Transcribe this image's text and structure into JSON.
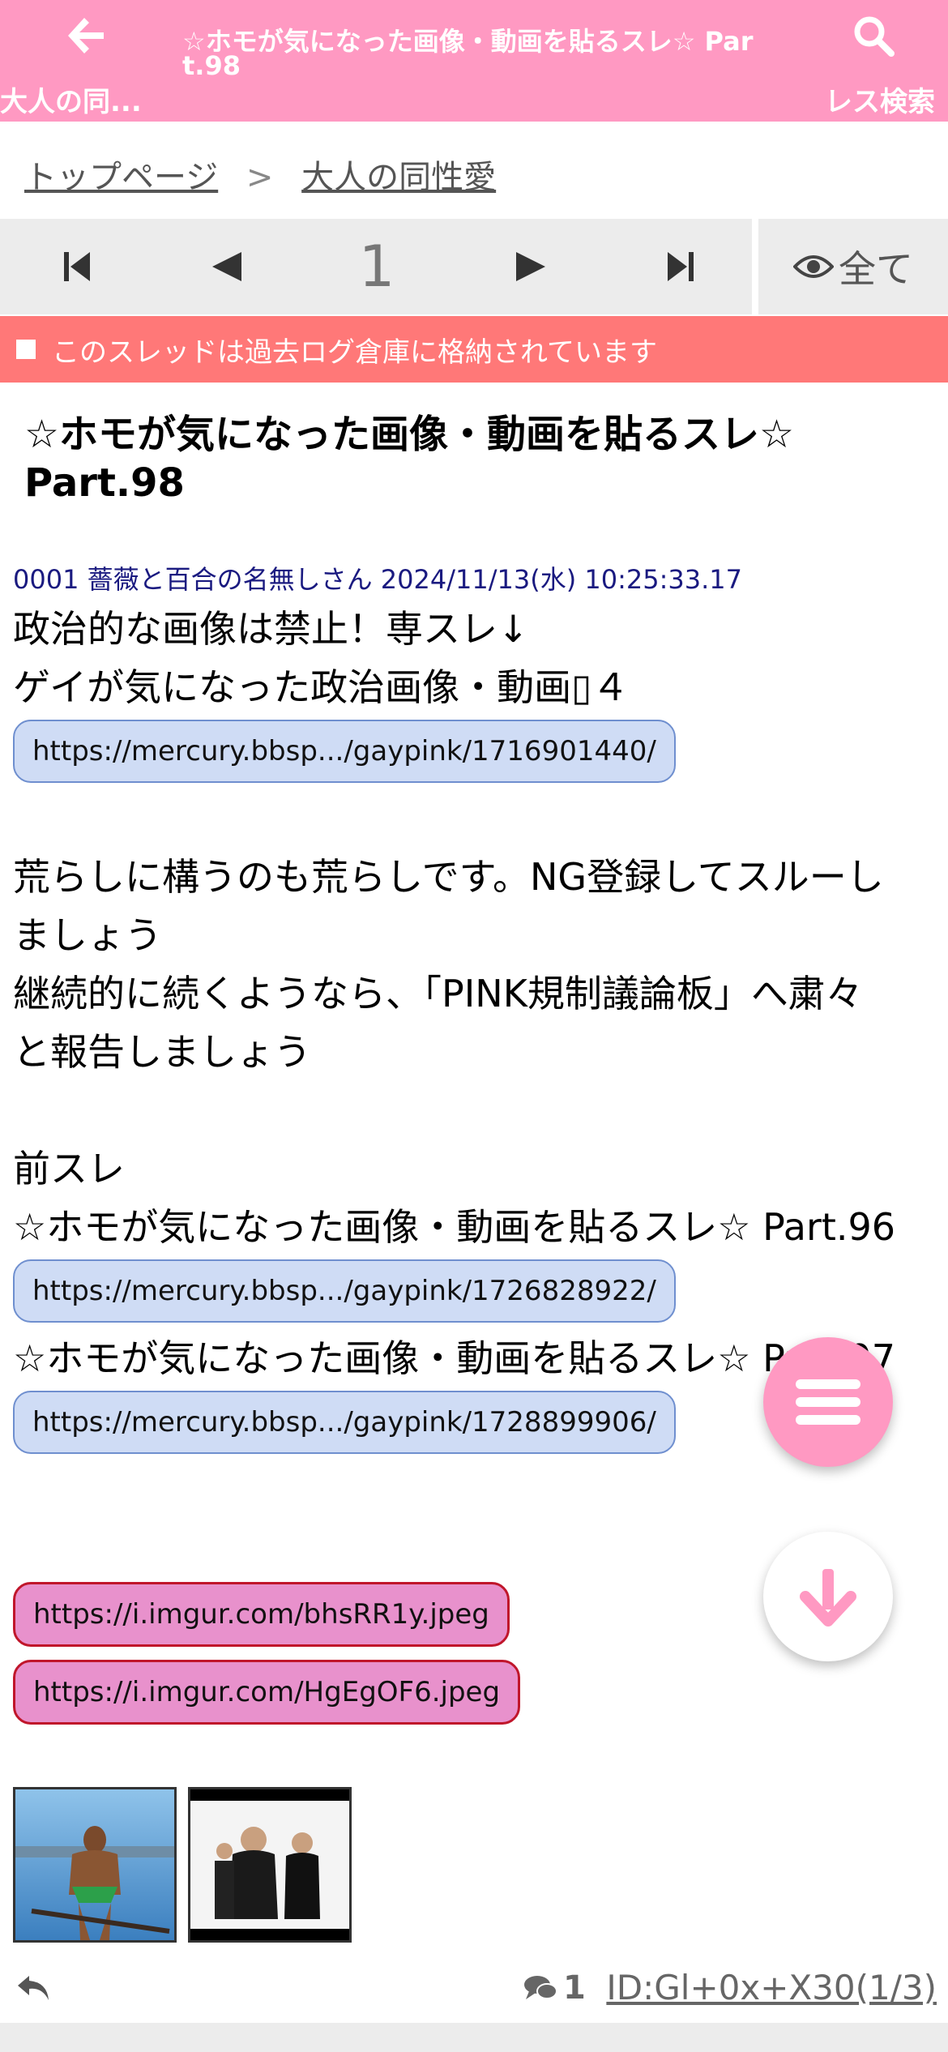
{
  "header": {
    "back_label": "大人の同...",
    "back_icon": "arrow-left-icon",
    "title": "☆ホモが気になった画像・動画を貼るスレ☆ Part.98",
    "search_label": "レス検索",
    "search_icon": "search-icon",
    "bg_color": "#ff99c2"
  },
  "breadcrumb": {
    "home": "トップページ",
    "separator": ">",
    "board": "大人の同性愛"
  },
  "pager": {
    "first_icon": "first-page-icon",
    "prev_icon": "prev-page-icon",
    "page": "1",
    "next_icon": "next-page-icon",
    "last_icon": "last-page-icon",
    "all_icon": "eye-icon",
    "all_label": "全て"
  },
  "notice": {
    "text": "このスレッドは過去ログ倉庫に格納されています",
    "bg_color": "#ff7878"
  },
  "thread": {
    "title": "☆ホモが気になった画像・動画を貼るスレ☆ Part.98"
  },
  "post": {
    "meta": "0001 薔薇と百合の名無しさん 2024/11/13(水) 10:25:33.17",
    "line1": "政治的な画像は禁止！専スレ↓",
    "line2": "ゲイが気になった政治画像・動画▯４",
    "link1": "https://mercury.bbsp.../gaypink/1716901440/",
    "line3": "荒らしに構うのも荒らしです。NG登録してスルーし",
    "line4": "ましょう",
    "line5": "継続的に続くようなら、「PINK規制議論板」へ粛々",
    "line6": "と報告しましょう",
    "line7": "前スレ",
    "line8": "☆ホモが気になった画像・動画を貼るスレ☆ Part.96",
    "link2": "https://mercury.bbsp.../gaypink/1726828922/",
    "line9": "☆ホモが気になった画像・動画を貼るスレ☆ Part.97",
    "link3": "https://mercury.bbsp.../gaypink/1728899906/",
    "image_link1": "https://i.imgur.com/bhsRR1y.jpeg",
    "image_link2": "https://i.imgur.com/HgEgOF6.jpeg"
  },
  "footer": {
    "reply_icon": "reply-icon",
    "comment_icon": "comments-icon",
    "reply_count": "1",
    "id_text": "ID:Gl+0x+X30(1/3)"
  },
  "fab": {
    "menu_icon": "hamburger-menu-icon",
    "down_icon": "arrow-down-icon"
  }
}
